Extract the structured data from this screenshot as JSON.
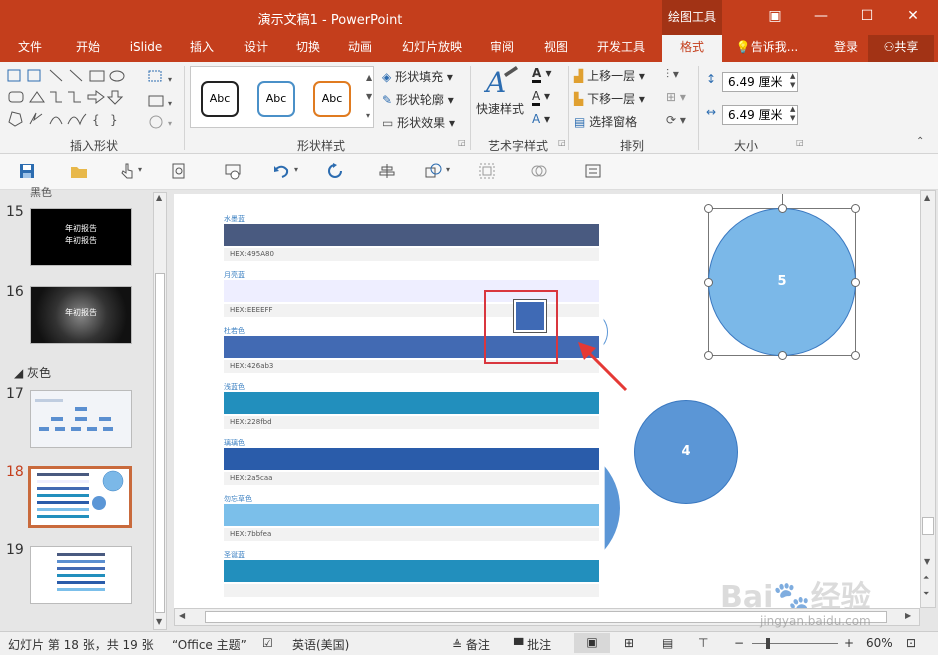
{
  "window": {
    "title": "演示文稿1 - PowerPoint",
    "context_tab_group": "绘图工具",
    "controls": {
      "ribbon_display": "▣",
      "minimize": "—",
      "maximize": "☐",
      "close": "✕"
    }
  },
  "ribbon_tabs": [
    "文件",
    "开始",
    "iSlide",
    "插入",
    "设计",
    "切换",
    "动画",
    "幻灯片放映",
    "审阅",
    "视图",
    "开发工具",
    "格式"
  ],
  "active_tab": "格式",
  "tell_me": "告诉我...",
  "signin": "登录",
  "share": "共享",
  "ribbon": {
    "insert_shapes_label": "插入形状",
    "shape_styles_label": "形状样式",
    "style_presets": [
      {
        "text": "Abc",
        "color": "#222222"
      },
      {
        "text": "Abc",
        "color": "#4a90c8"
      },
      {
        "text": "Abc",
        "color": "#e07b20"
      }
    ],
    "shape_fill": "形状填充",
    "shape_outline": "形状轮廓",
    "shape_effects": "形状效果",
    "quick_styles": "快速样式",
    "wordart_label": "艺术字样式",
    "bring_forward": "上移一层",
    "send_backward": "下移一层",
    "selection_pane": "选择窗格",
    "arrange_label": "排列",
    "height_value": "6.49 厘米",
    "width_value": "6.49 厘米",
    "size_label": "大小"
  },
  "thumbnails": {
    "section_top": "黑色",
    "section_gray": "灰色",
    "slides": [
      {
        "num": "15",
        "text": "年初报告\n年初报告"
      },
      {
        "num": "16",
        "text": "年初报告"
      },
      {
        "num": "17",
        "text": ""
      },
      {
        "num": "18",
        "text": ""
      },
      {
        "num": "19",
        "text": ""
      }
    ],
    "selected": "18"
  },
  "slide": {
    "colors": [
      {
        "name": "水墨蓝",
        "hex_label": "HEX:495A80",
        "hex": "#495a80"
      },
      {
        "name": "月亮蓝",
        "hex_label": "HEX:EEEEFF",
        "hex": "#eeeeff"
      },
      {
        "name": "杜若色",
        "hex_label": "HEX:426ab3",
        "hex": "#426ab3"
      },
      {
        "name": "浅蓝色",
        "hex_label": "HEX:228fbd",
        "hex": "#228fbd"
      },
      {
        "name": "璃璃色",
        "hex_label": "HEX:2a5caa",
        "hex": "#2a5caa"
      },
      {
        "name": "勿忘草色",
        "hex_label": "HEX:7bbfea",
        "hex": "#7bbfea"
      },
      {
        "name": "圣诞蓝",
        "hex_label": "",
        "hex": "#228fbd"
      }
    ],
    "circle_selected_label": "5",
    "circle_other_label": "4",
    "circle_selected_color": "#7bb8e8",
    "circle_other_color": "#5b96d6",
    "highlight_color": "#d9363e"
  },
  "status": {
    "slide_info": "幻灯片 第 18 张，共 19 张",
    "theme": "“Office 主题”",
    "language": "英语(美国)",
    "notes": "备注",
    "comments": "批注",
    "zoom": "60%"
  },
  "watermark": {
    "brand": "Bai",
    "brand2": "经验",
    "url": "jingyan.baidu.com"
  }
}
